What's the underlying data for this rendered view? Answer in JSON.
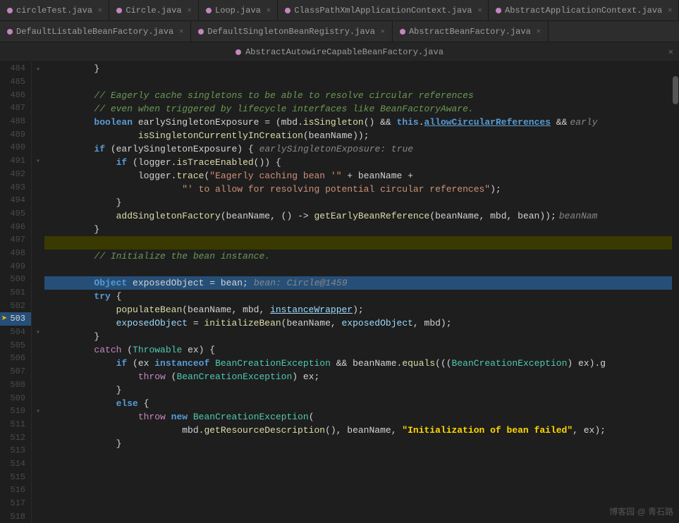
{
  "tabs_row1": [
    {
      "label": "circleTest.java",
      "active": false,
      "color": "#c586c0"
    },
    {
      "label": "Circle.java",
      "active": false,
      "color": "#c586c0"
    },
    {
      "label": "Loop.java",
      "active": false,
      "color": "#c586c0"
    },
    {
      "label": "ClassPathXmlApplicationContext.java",
      "active": false,
      "color": "#c586c0"
    },
    {
      "label": "AbstractApplicationContext.java",
      "active": false,
      "color": "#c586c0"
    }
  ],
  "tabs_row2": [
    {
      "label": "DefaultListableBeanFactory.java",
      "active": false,
      "color": "#c586c0"
    },
    {
      "label": "DefaultSingletonBeanRegistry.java",
      "active": false,
      "color": "#c586c0"
    },
    {
      "label": "AbstractBeanFactory.java",
      "active": false,
      "color": "#c586c0"
    }
  ],
  "file_path": "AbstractAutowireCapableBeanFactory.java",
  "watermark": "博客园 @ 青石路"
}
